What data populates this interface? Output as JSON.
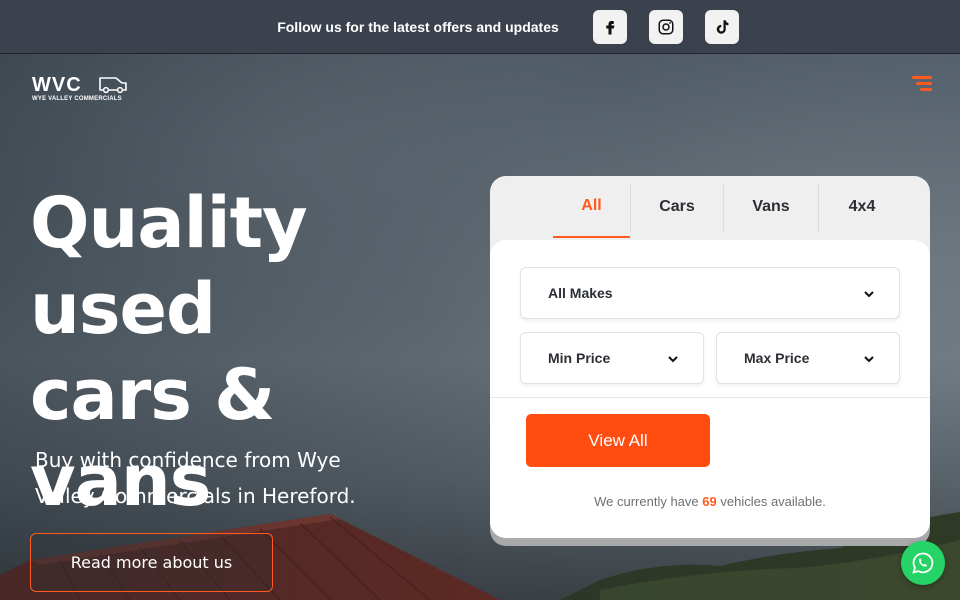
{
  "topbar": {
    "text": "Follow us for the latest offers and updates",
    "socials": [
      {
        "name": "facebook-icon"
      },
      {
        "name": "instagram-icon"
      },
      {
        "name": "tiktok-icon"
      }
    ]
  },
  "logo": {
    "main": "WVC",
    "sub": "WYE VALLEY COMMERCIALS"
  },
  "hero": {
    "headline_line1": "Quality",
    "headline_line2": "used",
    "headline_line3": "cars & vans",
    "subtext": "Buy with confidence from Wye Valley Commercials in Hereford.",
    "read_more_label": "Read more about us"
  },
  "search": {
    "tabs": [
      {
        "label": "All",
        "active": true
      },
      {
        "label": "Cars",
        "active": false
      },
      {
        "label": "Vans",
        "active": false
      },
      {
        "label": "4x4",
        "active": false
      }
    ],
    "make_select": "All Makes",
    "min_price_select": "Min Price",
    "max_price_select": "Max Price",
    "view_all_label": "View All",
    "availability_prefix": "We currently have",
    "availability_count": "69",
    "availability_suffix": "vehicles available."
  },
  "colors": {
    "accent": "#ff5a1f",
    "button": "#ff4d12",
    "topbar": "#3b424d",
    "whatsapp": "#25d366"
  }
}
